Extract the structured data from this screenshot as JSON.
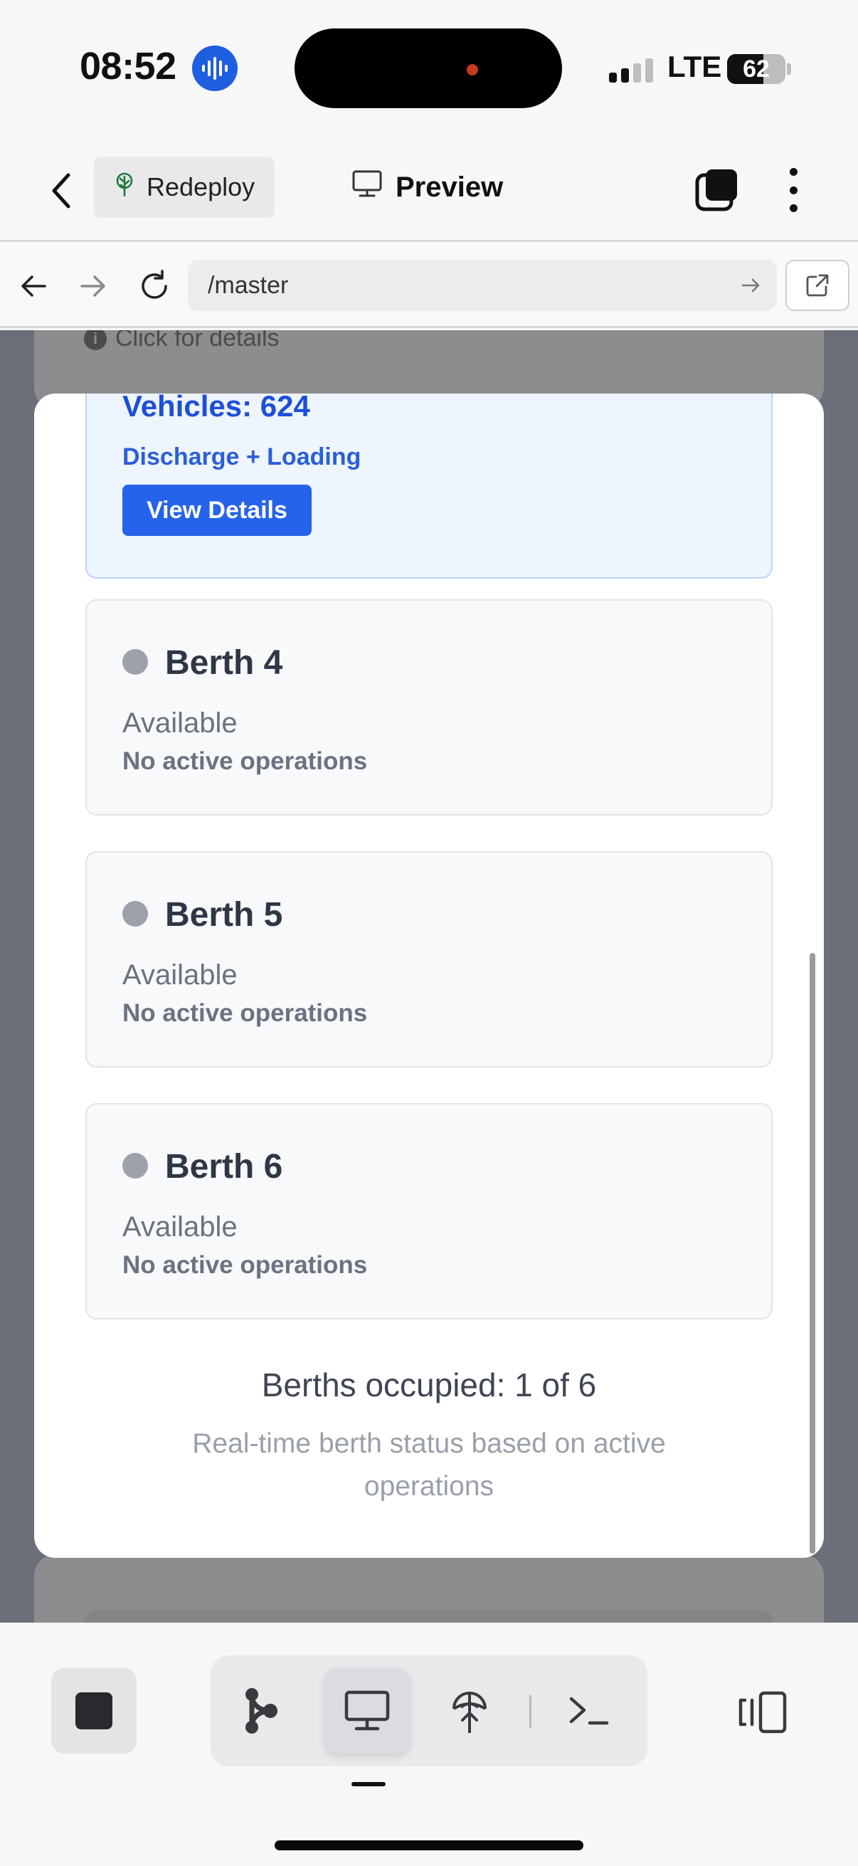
{
  "status_bar": {
    "time": "08:52",
    "carrier": "LTE",
    "battery": "62",
    "battery_level": 0.62,
    "signal_bars_active": 2,
    "signal_bars_total": 4
  },
  "header": {
    "redeploy_label": "Redeploy",
    "title": "Preview",
    "back_icon": "chevron-left-icon",
    "tabs_icon": "tabs-icon",
    "more_icon": "more-vertical-icon"
  },
  "url_bar": {
    "url": "/master"
  },
  "background": {
    "hint_text": "Click for details"
  },
  "active_berth": {
    "vehicles": "Vehicles: 624",
    "operation": "Discharge + Loading",
    "button_label": "View Details"
  },
  "berths": [
    {
      "name": "Berth 4",
      "status": "Available",
      "detail": "No active operations"
    },
    {
      "name": "Berth 5",
      "status": "Available",
      "detail": "No active operations"
    },
    {
      "name": "Berth 6",
      "status": "Available",
      "detail": "No active operations"
    }
  ],
  "summary": {
    "occupied": "Berths occupied: 1 of 6",
    "note": "Real-time berth status based on active operations"
  },
  "colors": {
    "accent": "#2563eb",
    "available_dot": "#9ca1aa",
    "overlay": "#6b6f78"
  },
  "toolbar": {
    "items": [
      "stop-icon",
      "graph-icon",
      "monitor-icon",
      "deploy-icon",
      "terminal-icon",
      "layout-icon"
    ],
    "active": "monitor-icon"
  }
}
